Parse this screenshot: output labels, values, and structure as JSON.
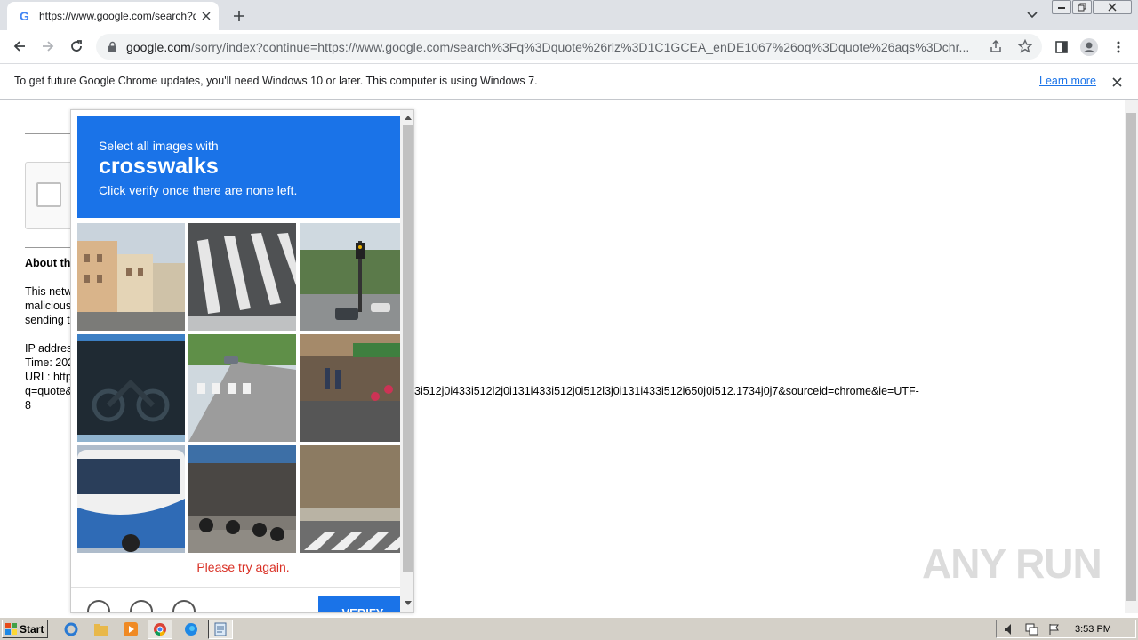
{
  "tab": {
    "title": "https://www.google.com/search?q=quote"
  },
  "omnibox": {
    "host": "google.com",
    "path": "/sorry/index?continue=https://www.google.com/search%3Fq%3Dquote%26rlz%3D1C1GCEA_enDE1067%26oq%3Dquote%26aqs%3Dchr..."
  },
  "infobar": {
    "message": "To get future Google Chrome updates, you'll need Windows 10 or later. This computer is using Windows 7.",
    "learn_more": "Learn more"
  },
  "page": {
    "about": "About th",
    "p1": [
      "This netw",
      "malicious",
      "sending t"
    ],
    "p2": [
      "IP addres",
      "Time: 202",
      "URL: http",
      "q=quote&",
      "8"
    ],
    "url_tail": "3i512j0i433i512l2j0i131i433i512j0i512l3j0i131i433i512i650j0i512.1734j0j7&sourceid=chrome&ie=UTF-"
  },
  "captcha": {
    "line1": "Select all images with",
    "keyword": "crosswalks",
    "line3": "Click verify once there are none left.",
    "error": "Please try again.",
    "verify_label": "VERIFY",
    "tiles": [
      "street-buildings",
      "crosswalk-closeup",
      "traffic-light-street",
      "dark-motorbike",
      "road-crosswalk",
      "street-shops",
      "bus",
      "parked-motorbikes",
      "sidewalk-crosswalk"
    ]
  },
  "watermark": "ANY RUN",
  "taskbar": {
    "start": "Start",
    "clock": "3:53 PM"
  },
  "colors": {
    "accent": "#1a73e8",
    "error": "#d93025",
    "tabstrip": "#dee1e6"
  }
}
